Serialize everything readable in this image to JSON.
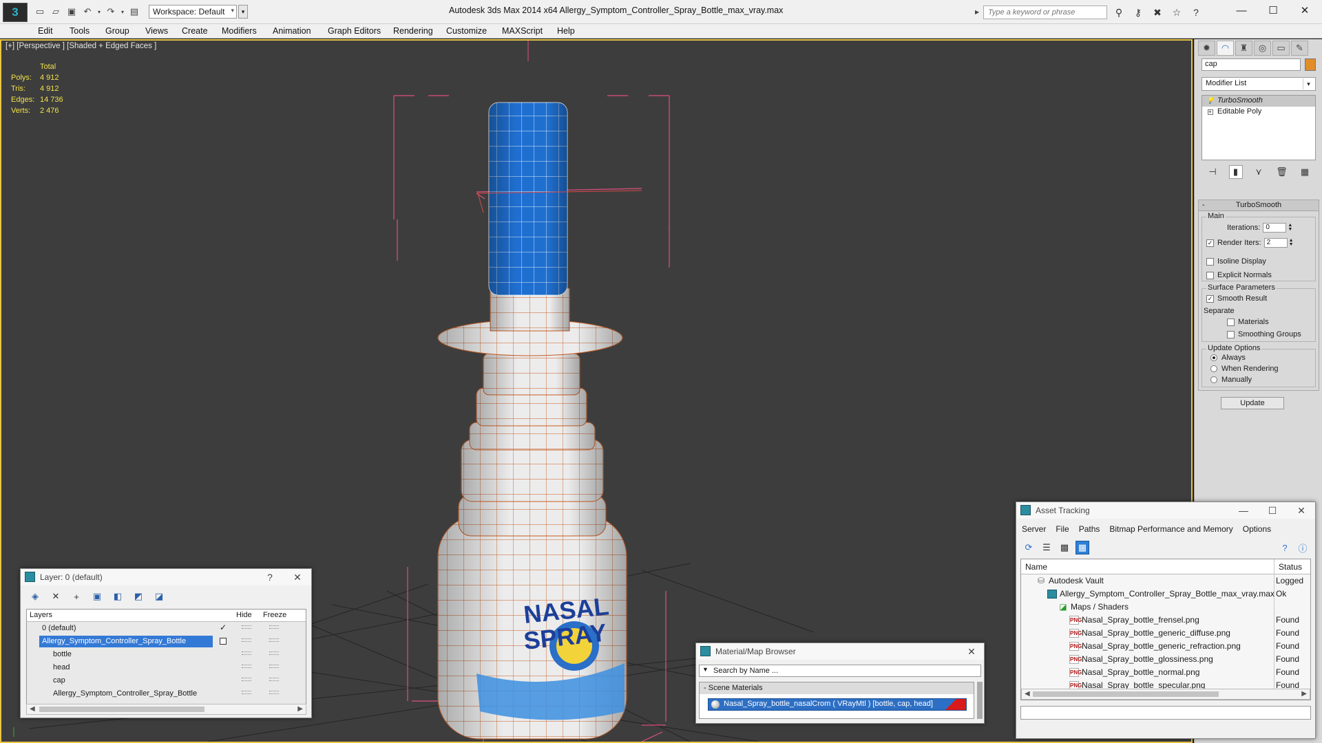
{
  "title_bar": {
    "workspace": "Workspace: Default",
    "app_title": "Autodesk 3ds Max  2014 x64       Allergy_Symptom_Controller_Spray_Bottle_max_vray.max",
    "search_placeholder": "Type a keyword or phrase"
  },
  "menu": [
    "Edit",
    "Tools",
    "Group",
    "Views",
    "Create",
    "Modifiers",
    "Animation",
    "Graph Editors",
    "Rendering",
    "Customize",
    "MAXScript",
    "Help"
  ],
  "viewport": {
    "label": "[+] [Perspective ] [Shaded + Edged Faces ]",
    "stats_header": "Total",
    "stats": [
      {
        "label": "Polys:",
        "value": "4 912"
      },
      {
        "label": "Tris:",
        "value": "4 912"
      },
      {
        "label": "Edges:",
        "value": "14 736"
      },
      {
        "label": "Verts:",
        "value": "2 476"
      }
    ],
    "label_text": [
      "NASAL",
      "SPRAY"
    ],
    "colors": {
      "cap": "#1f6fd0",
      "wire": "#c85a1e",
      "bbox": "#e0507e",
      "body": "#e9e9e9"
    }
  },
  "command_panel": {
    "object_name": "cap",
    "modifier_list": "Modifier List",
    "stack": [
      "TurboSmooth",
      "Editable Poly"
    ],
    "rollout_title": "TurboSmooth",
    "main_group": "Main",
    "iterations_label": "Iterations:",
    "iterations_value": "0",
    "render_iters_label": "Render Iters:",
    "render_iters_value": "2",
    "isoline": "Isoline Display",
    "explicit_normals": "Explicit Normals",
    "surface_group": "Surface Parameters",
    "smooth_result": "Smooth Result",
    "separate_label": "Separate",
    "materials": "Materials",
    "smoothing_groups": "Smoothing Groups",
    "update_group": "Update Options",
    "always": "Always",
    "when_rendering": "When Rendering",
    "manually": "Manually",
    "update_btn": "Update"
  },
  "layer_dialog": {
    "title": "Layer: 0 (default)",
    "help": "?",
    "col_layers": "Layers",
    "col_hide": "Hide",
    "col_freeze": "Freeze",
    "rows": [
      {
        "name": "0 (default)"
      },
      {
        "name": "Allergy_Symptom_Controller_Spray_Bottle"
      },
      {
        "name": "bottle"
      },
      {
        "name": "head"
      },
      {
        "name": "cap"
      },
      {
        "name": "Allergy_Symptom_Controller_Spray_Bottle"
      }
    ]
  },
  "material_browser": {
    "title": "Material/Map Browser",
    "search": "Search by Name ...",
    "group": "Scene Materials",
    "item": "Nasal_Spray_bottle_nasalCrom  ( VRayMtl )  [bottle, cap, head]"
  },
  "asset_tracking": {
    "title": "Asset Tracking",
    "menu": [
      "Server",
      "File",
      "Paths",
      "Bitmap Performance and Memory",
      "Options"
    ],
    "col_name": "Name",
    "col_status": "Status",
    "rows": [
      {
        "name": "Autodesk Vault",
        "status": "Logged"
      },
      {
        "name": "Allergy_Symptom_Controller_Spray_Bottle_max_vray.max",
        "status": "Ok"
      },
      {
        "name": "Maps / Shaders",
        "status": ""
      },
      {
        "name": "Nasal_Spray_bottle_frensel.png",
        "status": "Found"
      },
      {
        "name": "Nasal_Spray_bottle_generic_diffuse.png",
        "status": "Found"
      },
      {
        "name": "Nasal_Spray_bottle_generic_refraction.png",
        "status": "Found"
      },
      {
        "name": "Nasal_Spray_bottle_glossiness.png",
        "status": "Found"
      },
      {
        "name": "Nasal_Spray_bottle_normal.png",
        "status": "Found"
      },
      {
        "name": "Nasal_Spray_bottle_specular.png",
        "status": "Found"
      }
    ]
  }
}
